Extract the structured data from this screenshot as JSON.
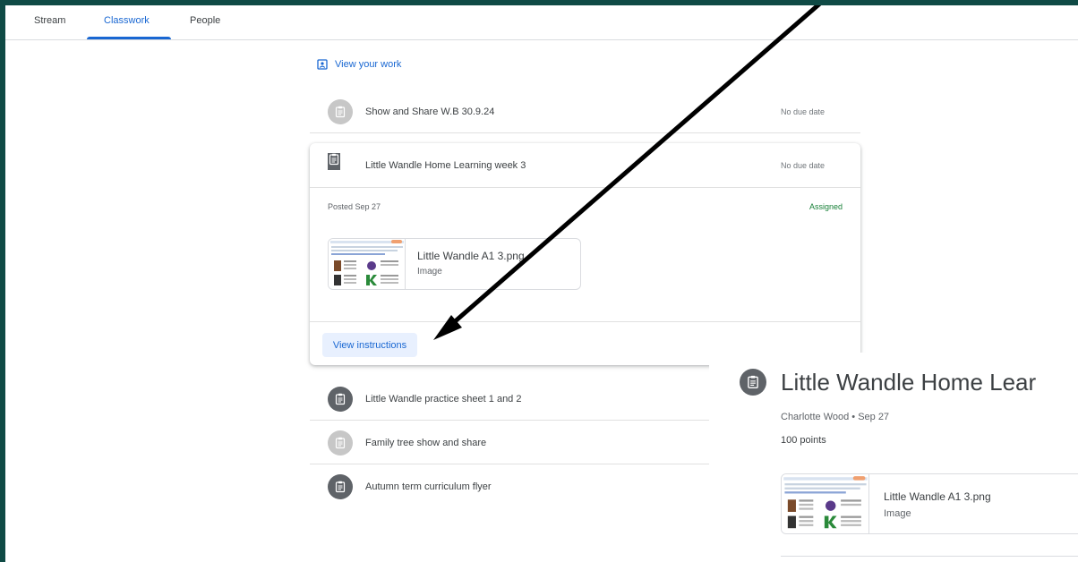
{
  "tabs": [
    {
      "label": "Stream"
    },
    {
      "label": "Classwork"
    },
    {
      "label": "People"
    }
  ],
  "view_your_work": "View your work",
  "items": [
    {
      "title": "Show and Share W.B 30.9.24",
      "due": "No due date"
    },
    {
      "title": "Little Wandle Home Learning week 3",
      "due": "No due date"
    },
    {
      "title": "Little Wandle practice sheet 1 and 2"
    },
    {
      "title": "Family tree show and share"
    },
    {
      "title": "Autumn term curriculum flyer"
    }
  ],
  "expanded": {
    "posted": "Posted Sep 27",
    "status": "Assigned",
    "attachment": {
      "name": "Little Wandle A1 3.png",
      "type": "Image"
    },
    "view_instructions": "View instructions"
  },
  "detail": {
    "title": "Little Wandle Home Lear",
    "meta": "Charlotte Wood • Sep 27",
    "points": "100 points",
    "attachment": {
      "name": "Little Wandle A1 3.png",
      "type": "Image"
    }
  },
  "colors": {
    "accent": "#1967d2",
    "assigned": "#188038",
    "background": "#0f4a45",
    "arrow": "#000000"
  },
  "icons": [
    "assignment-icon",
    "view-work-icon",
    "thumbnail-image"
  ]
}
